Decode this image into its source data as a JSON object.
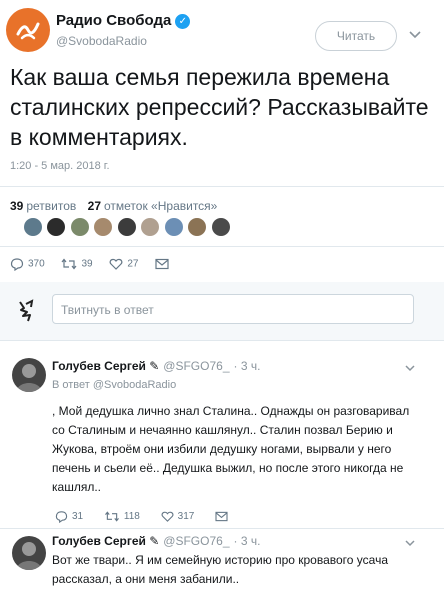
{
  "header": {
    "account_name": "Радио Свобода",
    "handle": "@SvobodaRadio",
    "follow_label": "Читать"
  },
  "tweet": {
    "text": "Как ваша семья пережила времена сталинских репрессий? Рассказывайте в комментариях.",
    "timestamp": "1:20 - 5 мар. 2018 г.",
    "retweets_count": "39",
    "retweets_label": "ретвитов",
    "likes_count": "27",
    "likes_label": "отметок «Нравится»",
    "replies": "370",
    "rt": "39",
    "likes": "27"
  },
  "reply_box": {
    "placeholder": "Твитнуть в ответ"
  },
  "comments": [
    {
      "name": "Голубев Сергей",
      "handle": "@SFGO76_",
      "time": "· 3 ч.",
      "reply_to": "В ответ @SvobodaRadio",
      "text": ", Мой дедушка лично знал Сталина.. Однажды он разговаривал со Сталиным и нечаянно кашлянул.. Сталин позвал Берию и Жукова, втроём они избили дедушку ногами, вырвали у него печень и сьели её.. Дедушка выжил, но после этого никогда не кашлял..",
      "replies": "31",
      "retweets": "118",
      "likes": "317"
    },
    {
      "name": "Голубев Сергей",
      "handle": "@SFGO76_",
      "time": "· 3 ч.",
      "text": "Вот же твари.. Я им семейную историю про кровавого усача рассказал, а они меня забанили.."
    }
  ],
  "colors": {
    "brand": "#e8722a",
    "verified": "#1da1f2",
    "text": "#14171a",
    "muted": "#8a949c"
  },
  "icons": [
    "radio-svoboda-logo",
    "verified-icon",
    "chevron-down-icon",
    "reply-icon",
    "retweet-icon",
    "like-icon",
    "message-icon"
  ]
}
